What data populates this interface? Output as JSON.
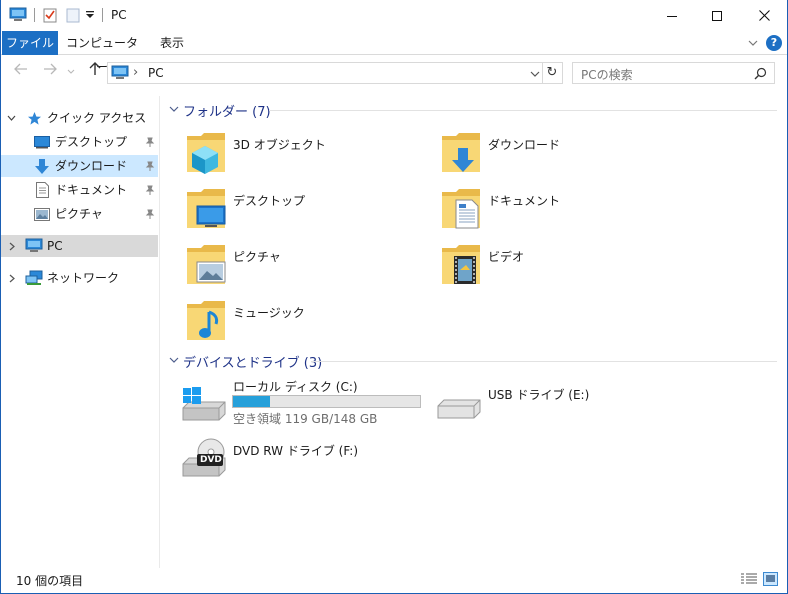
{
  "window": {
    "title": "PC",
    "minimize_icon": "minimize-icon",
    "maximize_icon": "maximize-icon",
    "close_icon": "close-icon"
  },
  "ribbon": {
    "tabs": [
      {
        "label": "ファイル",
        "active": true
      },
      {
        "label": "コンピューター",
        "active": false
      },
      {
        "label": "表示",
        "active": false
      }
    ],
    "help_label": "?"
  },
  "address_bar": {
    "path": "PC",
    "separator": "›",
    "refresh_glyph": "↻"
  },
  "search": {
    "placeholder": "PCの検索"
  },
  "navigation": {
    "quick_access": "クイック アクセス",
    "quick_items": [
      {
        "label": "デスクトップ",
        "icon": "desktop-icon",
        "pinned": true
      },
      {
        "label": "ダウンロード",
        "icon": "download-icon",
        "pinned": true,
        "selected": true
      },
      {
        "label": "ドキュメント",
        "icon": "document-icon",
        "pinned": true
      },
      {
        "label": "ピクチャ",
        "icon": "picture-icon",
        "pinned": true
      }
    ],
    "pc": "PC",
    "network": "ネットワーク"
  },
  "folders_group": {
    "title": "フォルダー (7)",
    "items": [
      {
        "label": "3D オブジェクト",
        "icon": "3d-objects-folder-icon"
      },
      {
        "label": "ダウンロード",
        "icon": "downloads-folder-icon"
      },
      {
        "label": "デスクトップ",
        "icon": "desktop-folder-icon"
      },
      {
        "label": "ドキュメント",
        "icon": "documents-folder-icon"
      },
      {
        "label": "ピクチャ",
        "icon": "pictures-folder-icon"
      },
      {
        "label": "ビデオ",
        "icon": "videos-folder-icon"
      },
      {
        "label": "ミュージック",
        "icon": "music-folder-icon"
      }
    ]
  },
  "drives_group": {
    "title": "デバイスとドライブ (3)",
    "local_disk": {
      "label": "ローカル ディスク (C:)",
      "free_text": "空き領域 119 GB/148 GB",
      "used_fraction": 0.196
    },
    "usb": {
      "label": "USB ドライブ (E:)"
    },
    "dvd": {
      "label": "DVD RW ドライブ (F:)",
      "badge": "DVD"
    }
  },
  "status": {
    "count": "10 個の項目"
  },
  "colors": {
    "accent": "#1c6fc4",
    "folder": "#e9b94a",
    "progress": "#26a0da",
    "group_title": "#1e3287",
    "selected_nav": "#cce8ff",
    "pc_nav": "#d9d9d9"
  }
}
